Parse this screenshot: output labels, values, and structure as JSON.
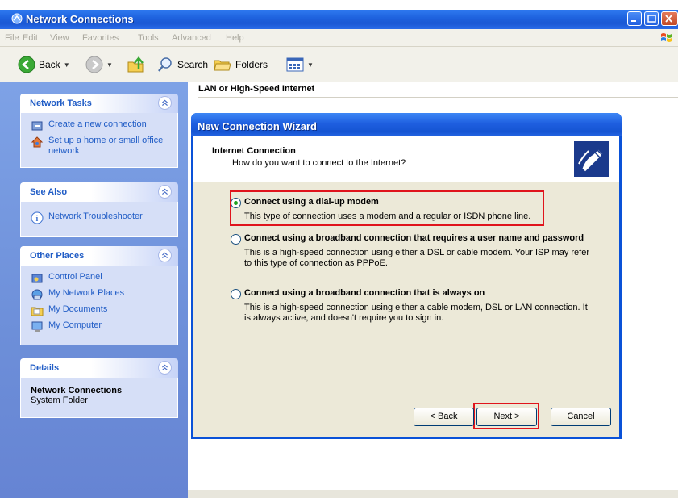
{
  "window": {
    "title": "Network Connections",
    "menu": [
      "File",
      "Edit",
      "View",
      "Favorites",
      "Tools",
      "Advanced",
      "Help"
    ]
  },
  "toolbar": {
    "back_label": "Back",
    "search_label": "Search",
    "folders_label": "Folders"
  },
  "content": {
    "group_header": "LAN or High-Speed Internet"
  },
  "sidebar": {
    "network_tasks": {
      "title": "Network Tasks",
      "items": [
        "Create a new connection",
        "Set up a home or small office network"
      ]
    },
    "see_also": {
      "title": "See Also",
      "items": [
        "Network Troubleshooter"
      ]
    },
    "other_places": {
      "title": "Other Places",
      "items": [
        "Control Panel",
        "My Network Places",
        "My Documents",
        "My Computer"
      ]
    },
    "details": {
      "title": "Details",
      "name": "Network Connections",
      "type": "System Folder"
    }
  },
  "wizard": {
    "title": "New Connection Wizard",
    "heading": "Internet Connection",
    "subheading": "How do you want to connect to the Internet?",
    "options": [
      {
        "title": "Connect using a dial-up modem",
        "desc": "This type of connection uses a modem and a regular or ISDN phone line.",
        "selected": true
      },
      {
        "title": "Connect using a broadband connection that requires a user name and password",
        "desc": "This is a high-speed connection using either a DSL or cable modem. Your ISP may refer to this type of connection as PPPoE.",
        "selected": false
      },
      {
        "title": "Connect using a broadband connection that is always on",
        "desc": "This is a high-speed connection using either a cable modem, DSL or LAN connection. It is always active, and doesn't require you to sign in.",
        "selected": false
      }
    ],
    "buttons": {
      "back": "< Back",
      "next": "Next >",
      "cancel": "Cancel"
    }
  },
  "colors": {
    "xp_blue": "#0a52d8",
    "task_link": "#215dc6",
    "highlight_red": "#e0141c"
  }
}
